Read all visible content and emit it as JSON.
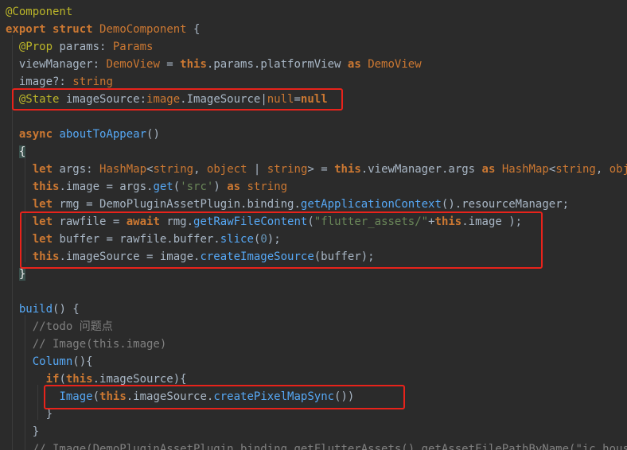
{
  "colors": {
    "background": "#2b2b2b",
    "annotation_box": "#e8231b",
    "keyword": "#cc7832",
    "decorator": "#bbb529",
    "function": "#56a8f5",
    "string": "#6a8759",
    "number": "#6897bb",
    "comment": "#808080",
    "text": "#a9b7c6"
  },
  "lines": [
    [
      {
        "c": "t-dec",
        "t": "@Component"
      }
    ],
    [
      {
        "c": "t-kw",
        "t": "export"
      },
      {
        "c": "t-plain",
        "t": " "
      },
      {
        "c": "t-kw",
        "t": "struct"
      },
      {
        "c": "t-plain",
        "t": " "
      },
      {
        "c": "t-type",
        "t": "DemoComponent"
      },
      {
        "c": "t-plain",
        "t": " {"
      }
    ],
    [
      {
        "c": "t-plain",
        "t": "  "
      },
      {
        "c": "t-dec",
        "t": "@Prop"
      },
      {
        "c": "t-plain",
        "t": " params: "
      },
      {
        "c": "t-type",
        "t": "Params"
      }
    ],
    [
      {
        "c": "t-plain",
        "t": "  viewManager: "
      },
      {
        "c": "t-type",
        "t": "DemoView"
      },
      {
        "c": "t-plain",
        "t": " = "
      },
      {
        "c": "t-kw",
        "t": "this"
      },
      {
        "c": "t-plain",
        "t": ".params.platformView "
      },
      {
        "c": "t-kw",
        "t": "as"
      },
      {
        "c": "t-plain",
        "t": " "
      },
      {
        "c": "t-type",
        "t": "DemoView"
      }
    ],
    [
      {
        "c": "t-plain",
        "t": "  image?: "
      },
      {
        "c": "t-type",
        "t": "string"
      }
    ],
    [
      {
        "c": "t-plain",
        "t": "  "
      },
      {
        "c": "t-dec",
        "t": "@State"
      },
      {
        "c": "t-plain",
        "t": " imageSource:"
      },
      {
        "c": "t-type",
        "t": "image"
      },
      {
        "c": "t-plain",
        "t": ".ImageSource|"
      },
      {
        "c": "t-type",
        "t": "null"
      },
      {
        "c": "t-plain",
        "t": "="
      },
      {
        "c": "t-kw",
        "t": "null"
      }
    ],
    [],
    [
      {
        "c": "t-plain",
        "t": "  "
      },
      {
        "c": "t-kw",
        "t": "async"
      },
      {
        "c": "t-plain",
        "t": " "
      },
      {
        "c": "t-fn",
        "t": "aboutToAppear"
      },
      {
        "c": "t-plain",
        "t": "()"
      }
    ],
    [
      {
        "c": "t-plain",
        "t": "  "
      },
      {
        "c": "t-brace-match",
        "t": "{"
      }
    ],
    [
      {
        "c": "t-plain",
        "t": "    "
      },
      {
        "c": "t-kw",
        "t": "let"
      },
      {
        "c": "t-plain",
        "t": " args: "
      },
      {
        "c": "t-type",
        "t": "HashMap"
      },
      {
        "c": "t-plain",
        "t": "<"
      },
      {
        "c": "t-type",
        "t": "string"
      },
      {
        "c": "t-plain",
        "t": ", "
      },
      {
        "c": "t-type",
        "t": "object"
      },
      {
        "c": "t-plain",
        "t": " | "
      },
      {
        "c": "t-type",
        "t": "string"
      },
      {
        "c": "t-plain",
        "t": "> = "
      },
      {
        "c": "t-kw",
        "t": "this"
      },
      {
        "c": "t-plain",
        "t": ".viewManager.args "
      },
      {
        "c": "t-kw",
        "t": "as"
      },
      {
        "c": "t-plain",
        "t": " "
      },
      {
        "c": "t-type",
        "t": "HashMap"
      },
      {
        "c": "t-plain",
        "t": "<"
      },
      {
        "c": "t-type",
        "t": "string"
      },
      {
        "c": "t-plain",
        "t": ", "
      },
      {
        "c": "t-type",
        "t": "object"
      },
      {
        "c": "t-plain",
        "t": ">"
      }
    ],
    [
      {
        "c": "t-plain",
        "t": "    "
      },
      {
        "c": "t-kw",
        "t": "this"
      },
      {
        "c": "t-plain",
        "t": ".image = args."
      },
      {
        "c": "t-method",
        "t": "get"
      },
      {
        "c": "t-plain",
        "t": "("
      },
      {
        "c": "t-str",
        "t": "'src'"
      },
      {
        "c": "t-plain",
        "t": ") "
      },
      {
        "c": "t-kw",
        "t": "as"
      },
      {
        "c": "t-plain",
        "t": " "
      },
      {
        "c": "t-type",
        "t": "string"
      }
    ],
    [
      {
        "c": "t-plain",
        "t": "    "
      },
      {
        "c": "t-kw",
        "t": "let"
      },
      {
        "c": "t-plain",
        "t": " rmg = DemoPluginAssetPlugin.binding."
      },
      {
        "c": "t-method",
        "t": "getApplicationContext"
      },
      {
        "c": "t-plain",
        "t": "().resourceManager;"
      }
    ],
    [
      {
        "c": "t-plain",
        "t": "    "
      },
      {
        "c": "t-kw",
        "t": "let"
      },
      {
        "c": "t-plain",
        "t": " rawfile = "
      },
      {
        "c": "t-kw",
        "t": "await"
      },
      {
        "c": "t-plain",
        "t": " rmg."
      },
      {
        "c": "t-method",
        "t": "getRawFileContent"
      },
      {
        "c": "t-plain",
        "t": "("
      },
      {
        "c": "t-str",
        "t": "\"flutter_assets/\""
      },
      {
        "c": "t-plain",
        "t": "+"
      },
      {
        "c": "t-kw",
        "t": "this"
      },
      {
        "c": "t-plain",
        "t": ".image );"
      }
    ],
    [
      {
        "c": "t-plain",
        "t": "    "
      },
      {
        "c": "t-kw",
        "t": "let"
      },
      {
        "c": "t-plain",
        "t": " buffer = rawfile.buffer."
      },
      {
        "c": "t-method",
        "t": "slice"
      },
      {
        "c": "t-plain",
        "t": "("
      },
      {
        "c": "t-num",
        "t": "0"
      },
      {
        "c": "t-plain",
        "t": ");"
      }
    ],
    [
      {
        "c": "t-plain",
        "t": "    "
      },
      {
        "c": "t-kw",
        "t": "this"
      },
      {
        "c": "t-plain",
        "t": ".imageSource = image."
      },
      {
        "c": "t-method",
        "t": "createImageSource"
      },
      {
        "c": "t-plain",
        "t": "(buffer);"
      }
    ],
    [
      {
        "c": "t-plain",
        "t": "  "
      },
      {
        "c": "t-brace-match",
        "t": "}"
      }
    ],
    [],
    [
      {
        "c": "t-plain",
        "t": "  "
      },
      {
        "c": "t-fn",
        "t": "build"
      },
      {
        "c": "t-plain",
        "t": "() {"
      }
    ],
    [
      {
        "c": "t-plain",
        "t": "    "
      },
      {
        "c": "t-cm",
        "t": "//todo 问题点"
      }
    ],
    [
      {
        "c": "t-plain",
        "t": "    "
      },
      {
        "c": "t-cm",
        "t": "// Image(this.image)"
      }
    ],
    [
      {
        "c": "t-plain",
        "t": "    "
      },
      {
        "c": "t-comp",
        "t": "Column"
      },
      {
        "c": "t-plain",
        "t": "(){"
      }
    ],
    [
      {
        "c": "t-plain",
        "t": "      "
      },
      {
        "c": "t-kw",
        "t": "if"
      },
      {
        "c": "t-plain",
        "t": "("
      },
      {
        "c": "t-kw",
        "t": "this"
      },
      {
        "c": "t-plain",
        "t": ".imageSource){"
      }
    ],
    [
      {
        "c": "t-plain",
        "t": "        "
      },
      {
        "c": "t-comp",
        "t": "Image"
      },
      {
        "c": "t-plain",
        "t": "("
      },
      {
        "c": "t-kw",
        "t": "this"
      },
      {
        "c": "t-plain",
        "t": ".imageSource."
      },
      {
        "c": "t-method",
        "t": "createPixelMapSync"
      },
      {
        "c": "t-plain",
        "t": "())"
      }
    ],
    [
      {
        "c": "t-plain",
        "t": "      }"
      }
    ],
    [
      {
        "c": "t-plain",
        "t": "    }"
      }
    ],
    [
      {
        "c": "t-plain",
        "t": "    "
      },
      {
        "c": "t-cm",
        "t": "// Image(DemoPluginAssetPlugin.binding.getFlutterAssets().getAssetFilePathByName(\"ic_house_det"
      }
    ]
  ]
}
